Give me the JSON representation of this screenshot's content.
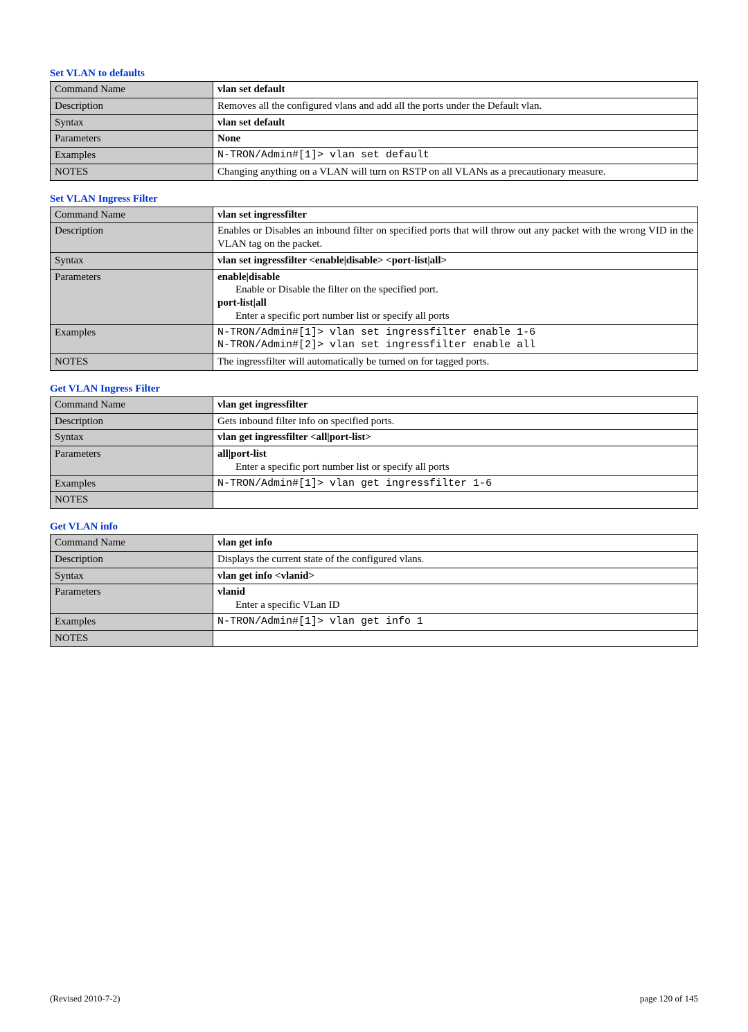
{
  "sections": [
    {
      "title": "Set VLAN to defaults",
      "commandName": "vlan set default",
      "description": "Removes all the configured vlans and add all the ports under the Default vlan.",
      "syntax": "vlan set default",
      "parameters": [
        {
          "name": "None",
          "desc": ""
        }
      ],
      "examples": [
        "N-TRON/Admin#[1]> vlan set default"
      ],
      "notes": "Changing anything on a VLAN will turn on RSTP on all VLANs as a precautionary measure."
    },
    {
      "title": "Set VLAN Ingress Filter",
      "commandName": "vlan set ingressfilter",
      "description": "Enables or Disables an inbound filter on specified ports that will throw out any packet with the wrong VID in the VLAN tag on the packet.",
      "syntax": "vlan set ingressfilter <enable|disable> <port-list|all>",
      "parameters": [
        {
          "name": "enable|disable",
          "desc": "Enable or Disable the filter on the specified port."
        },
        {
          "name": "port-list|all",
          "desc": "Enter a specific port number list or specify all ports"
        }
      ],
      "examples": [
        "N-TRON/Admin#[1]> vlan set ingressfilter enable 1-6",
        "N-TRON/Admin#[2]> vlan set ingressfilter enable all"
      ],
      "notes": "The ingressfilter will automatically be turned on for tagged ports."
    },
    {
      "title": "Get VLAN Ingress Filter",
      "commandName": "vlan get ingressfilter",
      "description": "Gets inbound filter info on specified ports.",
      "syntax": "vlan get ingressfilter <all|port-list>",
      "parameters": [
        {
          "name": "all|port-list",
          "desc": "Enter a specific port number list or specify all ports"
        }
      ],
      "examples": [
        "N-TRON/Admin#[1]> vlan get ingressfilter 1-6"
      ],
      "notes": ""
    },
    {
      "title": "Get VLAN info",
      "commandName": "vlan get info",
      "description": "Displays the current state of the configured vlans.",
      "syntax": "vlan get info <vlanid>",
      "parameters": [
        {
          "name": "vlanid",
          "desc": "Enter a specific VLan ID"
        }
      ],
      "examples": [
        "N-TRON/Admin#[1]> vlan get info 1"
      ],
      "notes": ""
    }
  ],
  "rowLabels": {
    "commandName": "Command Name",
    "description": "Description",
    "syntax": "Syntax",
    "parameters": "Parameters",
    "examples": "Examples",
    "notes": "NOTES"
  },
  "footer": {
    "left": "(Revised 2010-7-2)",
    "right": "page 120 of 145"
  }
}
